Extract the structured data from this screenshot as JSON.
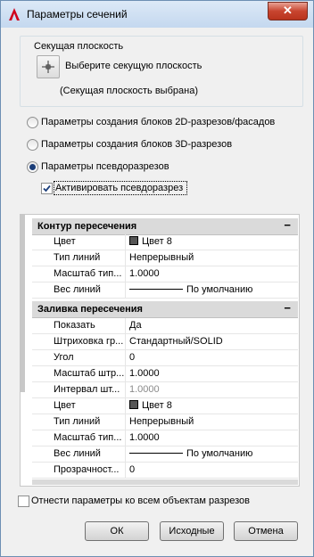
{
  "window": {
    "title": "Параметры сечений",
    "close_label": "✕"
  },
  "section_plane": {
    "group_title": "Секущая плоскость",
    "pick_label": "Выберите секущую плоскость",
    "status": "(Секущая плоскость выбрана)"
  },
  "radios": [
    {
      "label": "Параметры создания блоков 2D-разрезов/фасадов",
      "checked": false
    },
    {
      "label": "Параметры создания блоков 3D-разрезов",
      "checked": false
    },
    {
      "label": "Параметры псевдоразрезов",
      "checked": true
    }
  ],
  "activate_checkbox": {
    "label": "Активировать псевдоразрез",
    "checked": true
  },
  "sections": [
    {
      "title": "Контур пересечения",
      "collapse": "−",
      "rows": [
        {
          "name": "Цвет",
          "value": "Цвет 8"
        },
        {
          "name": "Тип линий",
          "value": "Непрерывный"
        },
        {
          "name": "Масштаб тип...",
          "value": "1.0000"
        },
        {
          "name": "Вес линий",
          "value": "По умолчанию"
        }
      ]
    },
    {
      "title": "Заливка пересечения",
      "collapse": "−",
      "rows": [
        {
          "name": "Показать",
          "value": "Да"
        },
        {
          "name": "Штриховка гр...",
          "value": "Стандартный/SOLID"
        },
        {
          "name": "Угол",
          "value": "0"
        },
        {
          "name": "Масштаб штр...",
          "value": "1.0000"
        },
        {
          "name": "Интервал шт...",
          "value": "1.0000"
        },
        {
          "name": "Цвет",
          "value": "Цвет 8"
        },
        {
          "name": "Тип линий",
          "value": "Непрерывный"
        },
        {
          "name": "Масштаб тип...",
          "value": "1.0000"
        },
        {
          "name": "Вес линий",
          "value": "По умолчанию"
        },
        {
          "name": "Прозрачност...",
          "value": "0"
        }
      ]
    }
  ],
  "apply_all": {
    "label": "Отнести параметры ко всем объектам разрезов",
    "checked": false
  },
  "buttons": {
    "ok": "ОК",
    "reset": "Исходные",
    "cancel": "Отмена"
  }
}
